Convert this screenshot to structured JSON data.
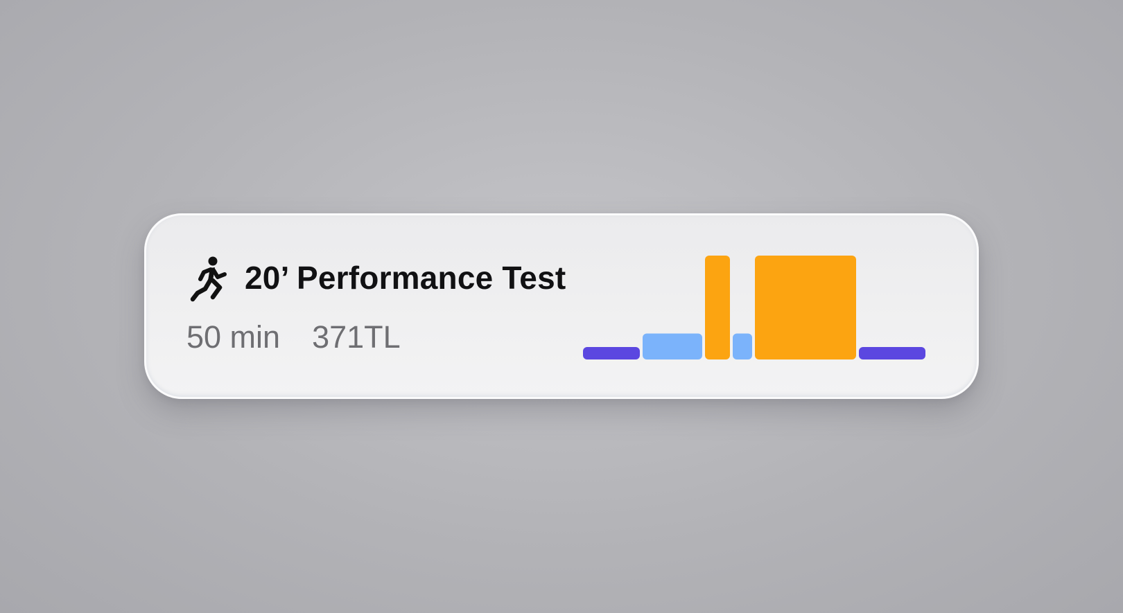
{
  "workout": {
    "icon": "running-figure-icon",
    "title": "20’ Performance Test",
    "duration": "50 min",
    "training_load": "371TL"
  },
  "chart_data": {
    "type": "bar",
    "description_of_segments": "workout interval blocks (variable width = duration share, height = intensity level)",
    "segments": [
      {
        "width": 82,
        "level": 1,
        "color": "#5b47e0"
      },
      {
        "width": 86,
        "level": 3,
        "color": "#7bb3fb"
      },
      {
        "width": 36,
        "level": 12,
        "color": "#fca411"
      },
      {
        "width": 28,
        "level": 3,
        "color": "#7bb3fb"
      },
      {
        "width": 146,
        "level": 12,
        "color": "#fca411"
      },
      {
        "width": 96,
        "level": 1,
        "color": "#5b47e0"
      }
    ],
    "ylim": [
      0,
      12
    ]
  },
  "colors": {
    "recovery": "#5b47e0",
    "endurance": "#7bb3fb",
    "threshold": "#fca411"
  }
}
